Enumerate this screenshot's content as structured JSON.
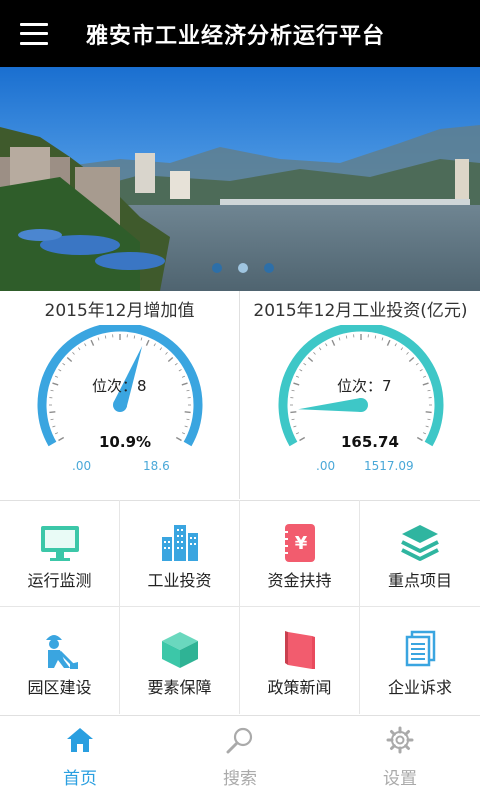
{
  "header": {
    "title": "雅安市工业经济分析运行平台",
    "menu_icon": "hamburger-menu-icon"
  },
  "banner": {
    "slides": 3,
    "active_slide": 1
  },
  "gauges": [
    {
      "title": "2015年12月增加值",
      "rank_label": "位次：8",
      "value": "10.9%",
      "min": ".00",
      "max": "18.6",
      "level": 0.586,
      "color": "#3aa5e0"
    },
    {
      "title": "2015年12月工业投资(亿元)",
      "rank_label": "位次：7",
      "value": "165.74",
      "min": ".00",
      "max": "1517.09",
      "level": 0.109,
      "color": "#3ec7c7"
    }
  ],
  "menu": [
    {
      "label": "运行监测",
      "icon": "monitor-icon",
      "color": "#3cc7a8"
    },
    {
      "label": "工业投资",
      "icon": "buildings-icon",
      "color": "#3aa5e0"
    },
    {
      "label": "资金扶持",
      "icon": "yuan-notebook-icon",
      "color": "#f25c6e"
    },
    {
      "label": "重点项目",
      "icon": "layers-icon",
      "color": "#2fb5a0"
    },
    {
      "label": "园区建设",
      "icon": "construction-worker-icon",
      "color": "#3aa5e0"
    },
    {
      "label": "要素保障",
      "icon": "box-icon",
      "color": "#3cc7a8"
    },
    {
      "label": "政策新闻",
      "icon": "book-icon",
      "color": "#f25c6e"
    },
    {
      "label": "企业诉求",
      "icon": "documents-icon",
      "color": "#3aa5e0"
    }
  ],
  "tabs": [
    {
      "label": "首页",
      "icon": "home-icon",
      "active": true
    },
    {
      "label": "搜索",
      "icon": "search-icon",
      "active": false
    },
    {
      "label": "设置",
      "icon": "gear-icon",
      "active": false
    }
  ],
  "colors": {
    "accent": "#3aa5e0",
    "active_tab": "#2a9fe0",
    "inactive_tab": "#aaaaaa",
    "header_bg": "#000000"
  }
}
